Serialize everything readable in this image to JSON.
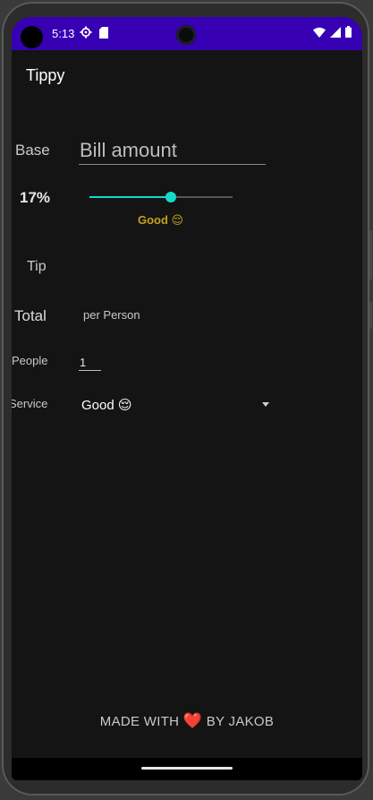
{
  "status_bar": {
    "time": "5:13",
    "icons": [
      "gear-icon",
      "sd-card-icon",
      "wifi-icon",
      "signal-icon",
      "battery-icon"
    ]
  },
  "app": {
    "title": "Tippy"
  },
  "form": {
    "base_label": "Base",
    "bill_placeholder": "Bill amount",
    "bill_value": "",
    "tip_percent_label": "17%",
    "tip_slider": {
      "value": 17,
      "min": 0,
      "max": 30
    },
    "tip_description": "Good 😌",
    "tip_label": "Tip",
    "tip_amount": "",
    "total_label": "Total",
    "per_person_label": "per Person",
    "people_label": "People",
    "people_value": "1",
    "service_label": "Service",
    "service_selected": "Good 😌"
  },
  "footer": {
    "prefix": "MADE WITH",
    "heart": "❤️",
    "suffix": "BY JAKOB"
  },
  "colors": {
    "status_bar": "#3700b3",
    "background": "#141414",
    "accent": "#16d9c9",
    "tip_description": "#c3a21e",
    "heart": "#cc2b2b"
  }
}
